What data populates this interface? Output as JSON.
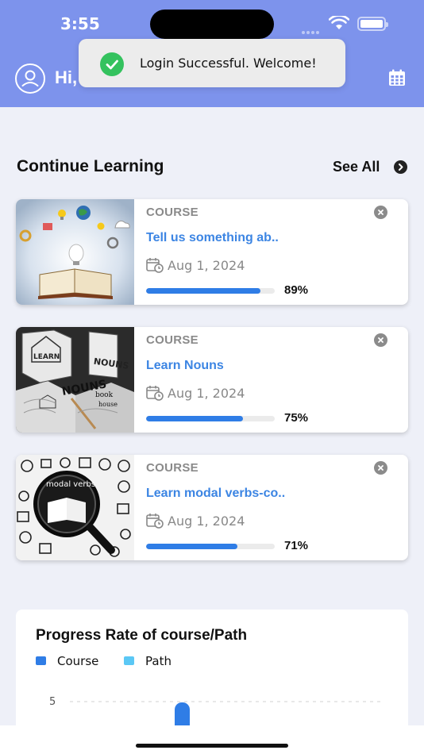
{
  "status_bar": {
    "time": "3:55"
  },
  "header": {
    "greeting": "Hi,"
  },
  "toast": {
    "message": "Login Successful. Welcome!"
  },
  "continue_learning": {
    "title": "Continue Learning",
    "see_all": "See All",
    "courses": [
      {
        "type": "COURSE",
        "title": "Tell us something ab..",
        "date": "Aug 1, 2024",
        "progress": 89,
        "progress_label": "89%",
        "thumbnail": "book-ideas-image"
      },
      {
        "type": "COURSE",
        "title": "Learn Nouns",
        "date": "Aug 1, 2024",
        "progress": 75,
        "progress_label": "75%",
        "thumbnail": "nouns-book-image"
      },
      {
        "type": "COURSE",
        "title": "Learn modal verbs-co..",
        "date": "Aug 1, 2024",
        "progress": 71,
        "progress_label": "71%",
        "thumbnail": "modal-verbs-magnifier-image"
      }
    ]
  },
  "chart": {
    "title": "Progress Rate of course/Path",
    "legend": [
      {
        "label": "Course",
        "color": "#2f7de6"
      },
      {
        "label": "Path",
        "color": "#5bc8f5"
      }
    ]
  },
  "chart_data": {
    "type": "bar",
    "title": "Progress Rate of course/Path",
    "series": [
      {
        "name": "Course"
      },
      {
        "name": "Path"
      }
    ],
    "y_ticks": [
      "5"
    ]
  },
  "colors": {
    "header": "#7d93ec",
    "accent": "#2f7de6",
    "title_blue": "#3c85e3",
    "success": "#34c25e"
  }
}
